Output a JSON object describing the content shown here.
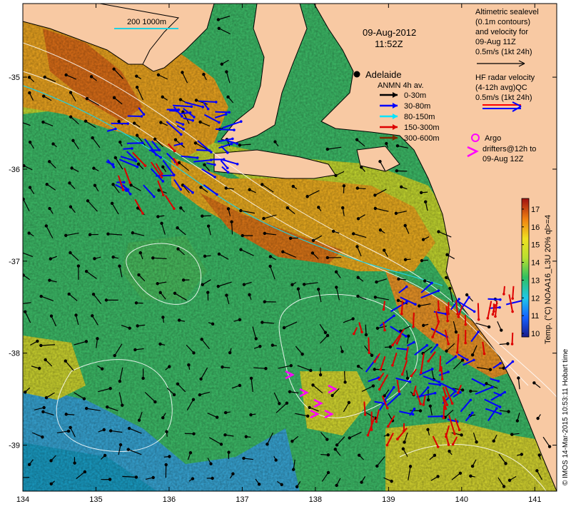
{
  "date": "09-Aug-2012",
  "time": "11:52Z",
  "city": "Adelaide",
  "scale_label": "200  1000m",
  "legend_altimetry": [
    "Altimetric sealevel",
    "(0.1m contours)",
    "and velocity for",
    "09-Aug 11Z",
    "0.5m/s (1kt 24h)"
  ],
  "legend_hf": [
    "HF radar velocity",
    "(4-12h avg)QC",
    "0.5m/s (1kt 24h)"
  ],
  "legend_anmn": {
    "title": "ANMN 4h av.",
    "items": [
      {
        "label": "0-30m",
        "color": "#000000"
      },
      {
        "label": "30-80m",
        "color": "#0000ff"
      },
      {
        "label": "80-150m",
        "color": "#00e5ff"
      },
      {
        "label": "150-300m",
        "color": "#dd0000"
      },
      {
        "label": "300-600m",
        "color": "#7a2a00"
      }
    ]
  },
  "legend_argo": [
    "Argo",
    "drifters@12h to",
    "09-Aug 12Z"
  ],
  "colorbar": {
    "label": "Temp. (°C) NOAA16_L3U 20% ql>=4",
    "ticks": [
      10,
      11,
      12,
      13,
      14,
      15,
      16,
      17
    ]
  },
  "credit": "© IMOS 14-Mar-2015 10:53:11 Hobart time",
  "map": {
    "lon_ticks": [
      134,
      135,
      136,
      137,
      138,
      139,
      140,
      141
    ],
    "lat_ticks": [
      -35,
      -36,
      -37,
      -38,
      -39
    ],
    "lon_range": [
      134,
      141.3
    ],
    "lat_range": [
      -39.5,
      -34.2
    ]
  },
  "colors": {
    "land": "#f8c9a3",
    "warm": "#f0a020",
    "mid": "#c8e030",
    "cool": "#30c060",
    "deep": "#3aa8d8",
    "hf_red": "#ff0000",
    "hf_blue": "#0000ff",
    "argo": "#ff00ff"
  }
}
